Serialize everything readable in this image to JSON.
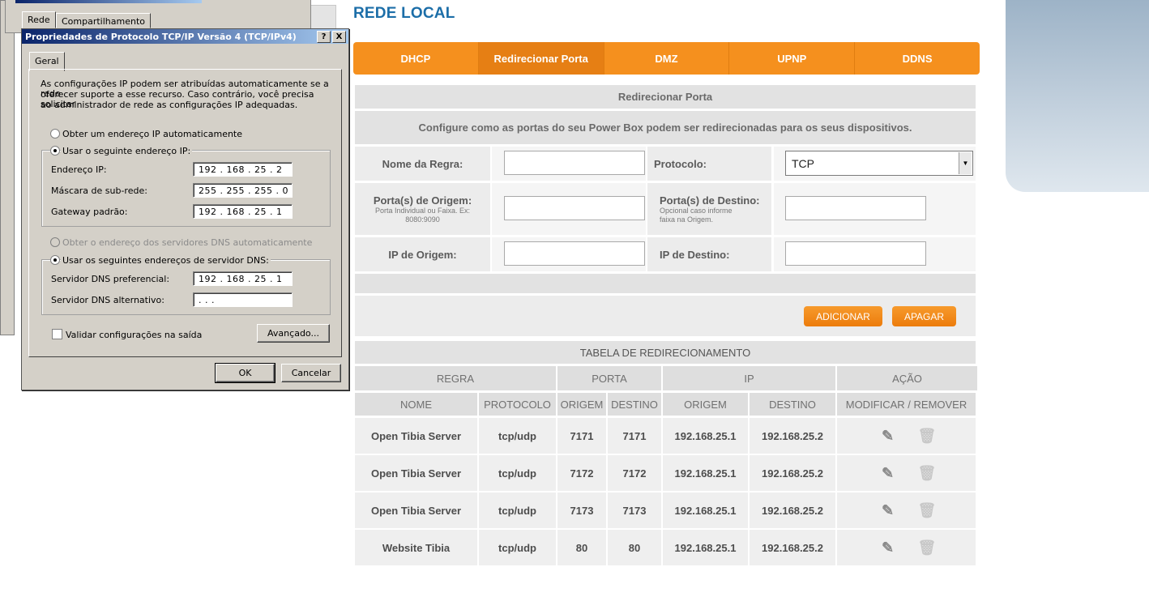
{
  "router": {
    "title": "REDE LOCAL",
    "tabs": [
      "DHCP",
      "Redirecionar Porta",
      "DMZ",
      "UPNP",
      "DDNS"
    ],
    "section_title": "Redirecionar Porta",
    "description": "Configure como as portas do seu Power Box podem ser redirecionadas para os seus dispositivos.",
    "form": {
      "rule_name_label": "Nome da Regra:",
      "protocol_label": "Protocolo:",
      "protocol_value": "TCP",
      "src_port_label": "Porta(s) de Origem:",
      "src_port_hint": "Porta Individual ou Faixa. Ex: 8080:9090",
      "dst_port_label": "Porta(s) de Destino:",
      "dst_port_hint": "Opcional caso informe faixa na Origem.",
      "src_ip_label": "IP de Origem:",
      "dst_ip_label": "IP de Destino:"
    },
    "buttons": {
      "add": "ADICIONAR",
      "delete": "APAGAR"
    },
    "table": {
      "title": "TABELA DE REDIRECIONAMENTO",
      "group_headers": [
        "REGRA",
        "PORTA",
        "IP",
        "AÇÃO"
      ],
      "headers": [
        "NOME",
        "PROTOCOLO",
        "ORIGEM",
        "DESTINO",
        "ORIGEM",
        "DESTINO",
        "MODIFICAR / REMOVER"
      ],
      "rows": [
        [
          "Open Tibia Server",
          "tcp/udp",
          "7171",
          "7171",
          "192.168.25.1",
          "192.168.25.2"
        ],
        [
          "Open Tibia Server",
          "tcp/udp",
          "7172",
          "7172",
          "192.168.25.1",
          "192.168.25.2"
        ],
        [
          "Open Tibia Server",
          "tcp/udp",
          "7173",
          "7173",
          "192.168.25.1",
          "192.168.25.2"
        ],
        [
          "Website Tibia",
          "tcp/udp",
          "80",
          "80",
          "192.168.25.1",
          "192.168.25.2"
        ]
      ]
    }
  },
  "dialog": {
    "back_tabs": [
      "Rede",
      "Compartilhamento"
    ],
    "title": "Propriedades de Protocolo TCP/IP Versão 4 (TCP/IPv4)",
    "help_btn": "?",
    "close_btn": "X",
    "tab": "Geral",
    "intro": [
      "As configurações IP podem ser atribuídas automaticamente se a rede",
      "oferecer suporte a esse recurso. Caso contrário, você precisa solicitar",
      "ao administrador de rede as configurações IP adequadas."
    ],
    "auto_ip": "Obter um endereço IP automaticamente",
    "manual_ip": "Usar o seguinte endereço IP:",
    "ip_label": "Endereço IP:",
    "ip_value": "192 . 168 .  25  .   2",
    "mask_label": "Máscara de sub-rede:",
    "mask_value": "255 . 255 . 255 .   0",
    "gw_label": "Gateway padrão:",
    "gw_value": "192 . 168 .  25  .   1",
    "auto_dns": "Obter o endereço dos servidores DNS automaticamente",
    "manual_dns": "Usar os seguintes endereços de servidor DNS:",
    "dns1_label": "Servidor DNS preferencial:",
    "dns1_value": "192 . 168 .  25  .   1",
    "dns2_label": "Servidor DNS alternativo:",
    "dns2_value": "      .        .        .",
    "validate": "Validar configurações na saída",
    "advanced": "Avançado...",
    "ok": "OK",
    "cancel": "Cancelar"
  }
}
